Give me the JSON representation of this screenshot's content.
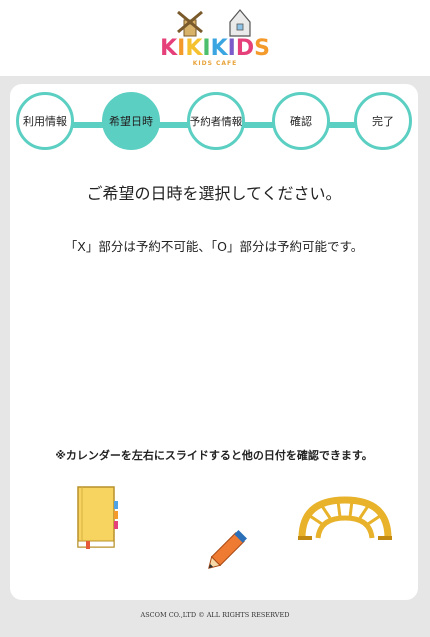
{
  "header": {
    "logo_text": "KIKIKIDS",
    "logo_sub": "KIDS CAFE"
  },
  "steps": [
    {
      "label": "利用情報",
      "active": false
    },
    {
      "label": "希望日時",
      "active": true
    },
    {
      "label": "予約者情報",
      "active": false
    },
    {
      "label": "確認",
      "active": false
    },
    {
      "label": "完了",
      "active": false
    }
  ],
  "main": {
    "title": "ご希望の日時を選択してください。",
    "availability_note": "「X」部分は予約不可能、「O」部分は予約可能です。",
    "scroll_note": "※カレンダーを左右にスライドすると他の日付を確認できます。"
  },
  "footer": {
    "copyright": "ASCOM CO.,LTD © ALL RIGHTS RESERVED"
  },
  "colors": {
    "accent": "#5ccfc3",
    "background": "#e6e6e6"
  }
}
